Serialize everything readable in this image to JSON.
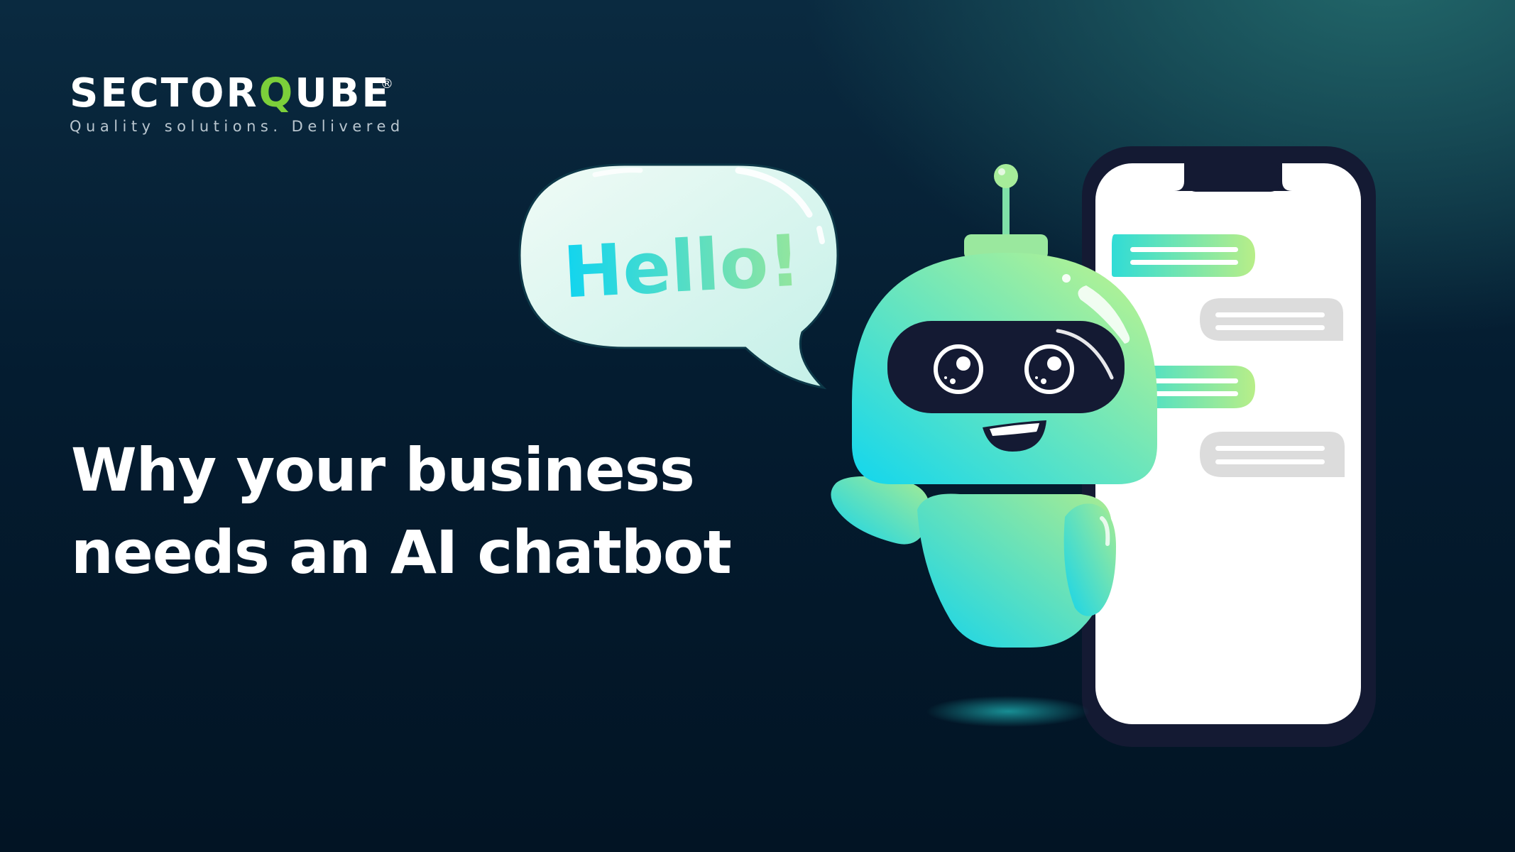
{
  "brand": {
    "name_prefix": "SECTOR",
    "name_q": "Q",
    "name_suffix": "UBE",
    "registered": "®",
    "tagline": "Quality solutions. Delivered",
    "accent_color": "#7ccf3a"
  },
  "headline": {
    "line1": "Why your business",
    "line2": "needs an AI chatbot"
  },
  "speech_bubble": {
    "text": "Hello!"
  },
  "illustration": {
    "subject": "robot-icon",
    "device": "smartphone-icon",
    "chat_messages": [
      "bot",
      "user",
      "bot",
      "user"
    ]
  },
  "colors": {
    "background": "#041c30",
    "robot_gradient_start": "#b8f08a",
    "robot_gradient_end": "#12d6ee",
    "phone_frame": "#141a33"
  }
}
